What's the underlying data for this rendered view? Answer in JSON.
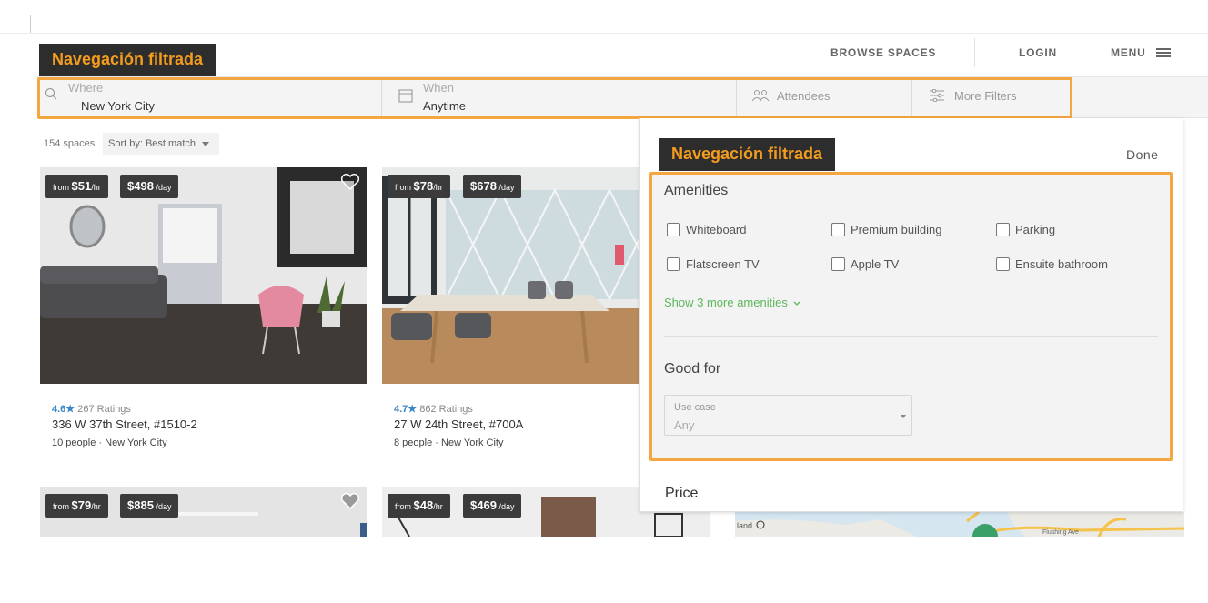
{
  "header": {
    "browse_label": "BROWSE SPACES",
    "login_label": "LOGIN",
    "menu_label": "MENU"
  },
  "annotations": {
    "top_label": "Navegación filtrada",
    "panel_label": "Navegación filtrada"
  },
  "search": {
    "where_label": "Where",
    "where_value": "New York City",
    "when_label": "When",
    "when_value": "Anytime",
    "attendees_label": "Attendees",
    "more_filters_label": "More Filters"
  },
  "results": {
    "count": "154 spaces",
    "sort_label": "Sort by:",
    "sort_value": "Best match"
  },
  "cards": [
    {
      "from": "from",
      "hourly": "$51",
      "hr": "/hr",
      "daily": "$498",
      "day": "/day",
      "score": "4.6★",
      "ratings": "267 Ratings",
      "address": "336 W 37th Street, #1510-2",
      "people": "10 people",
      "city": "New York City"
    },
    {
      "from": "from",
      "hourly": "$78",
      "hr": "/hr",
      "daily": "$678",
      "day": "/day",
      "score": "4.7★",
      "ratings": "862 Ratings",
      "address": "27 W 24th Street, #700A",
      "people": "8 people",
      "city": "New York City"
    },
    {
      "from": "from",
      "hourly": "$79",
      "hr": "/hr",
      "daily": "$885",
      "day": "/day"
    },
    {
      "from": "from",
      "hourly": "$48",
      "hr": "/hr",
      "daily": "$469",
      "day": "/day"
    }
  ],
  "meta_separator": "·",
  "filters": {
    "done_label": "Done",
    "amenities_title": "Amenities",
    "amenities": [
      {
        "label": "Whiteboard",
        "checked": false
      },
      {
        "label": "Premium building",
        "checked": false
      },
      {
        "label": "Parking",
        "checked": false
      },
      {
        "label": "Flatscreen TV",
        "checked": false
      },
      {
        "label": "Apple TV",
        "checked": false
      },
      {
        "label": "Ensuite bathroom",
        "checked": false
      }
    ],
    "show_more": "Show 3 more amenities",
    "good_for_title": "Good for",
    "use_case_label": "Use case",
    "use_case_value": "Any",
    "price_title": "Price"
  },
  "map": {
    "labels": [
      "land",
      "Flushing Ave"
    ]
  },
  "colors": {
    "annotation_text": "#f39c1e",
    "highlight_border": "#f4a640",
    "rating_blue": "#3b86c8",
    "link_green": "#5cb85c"
  }
}
